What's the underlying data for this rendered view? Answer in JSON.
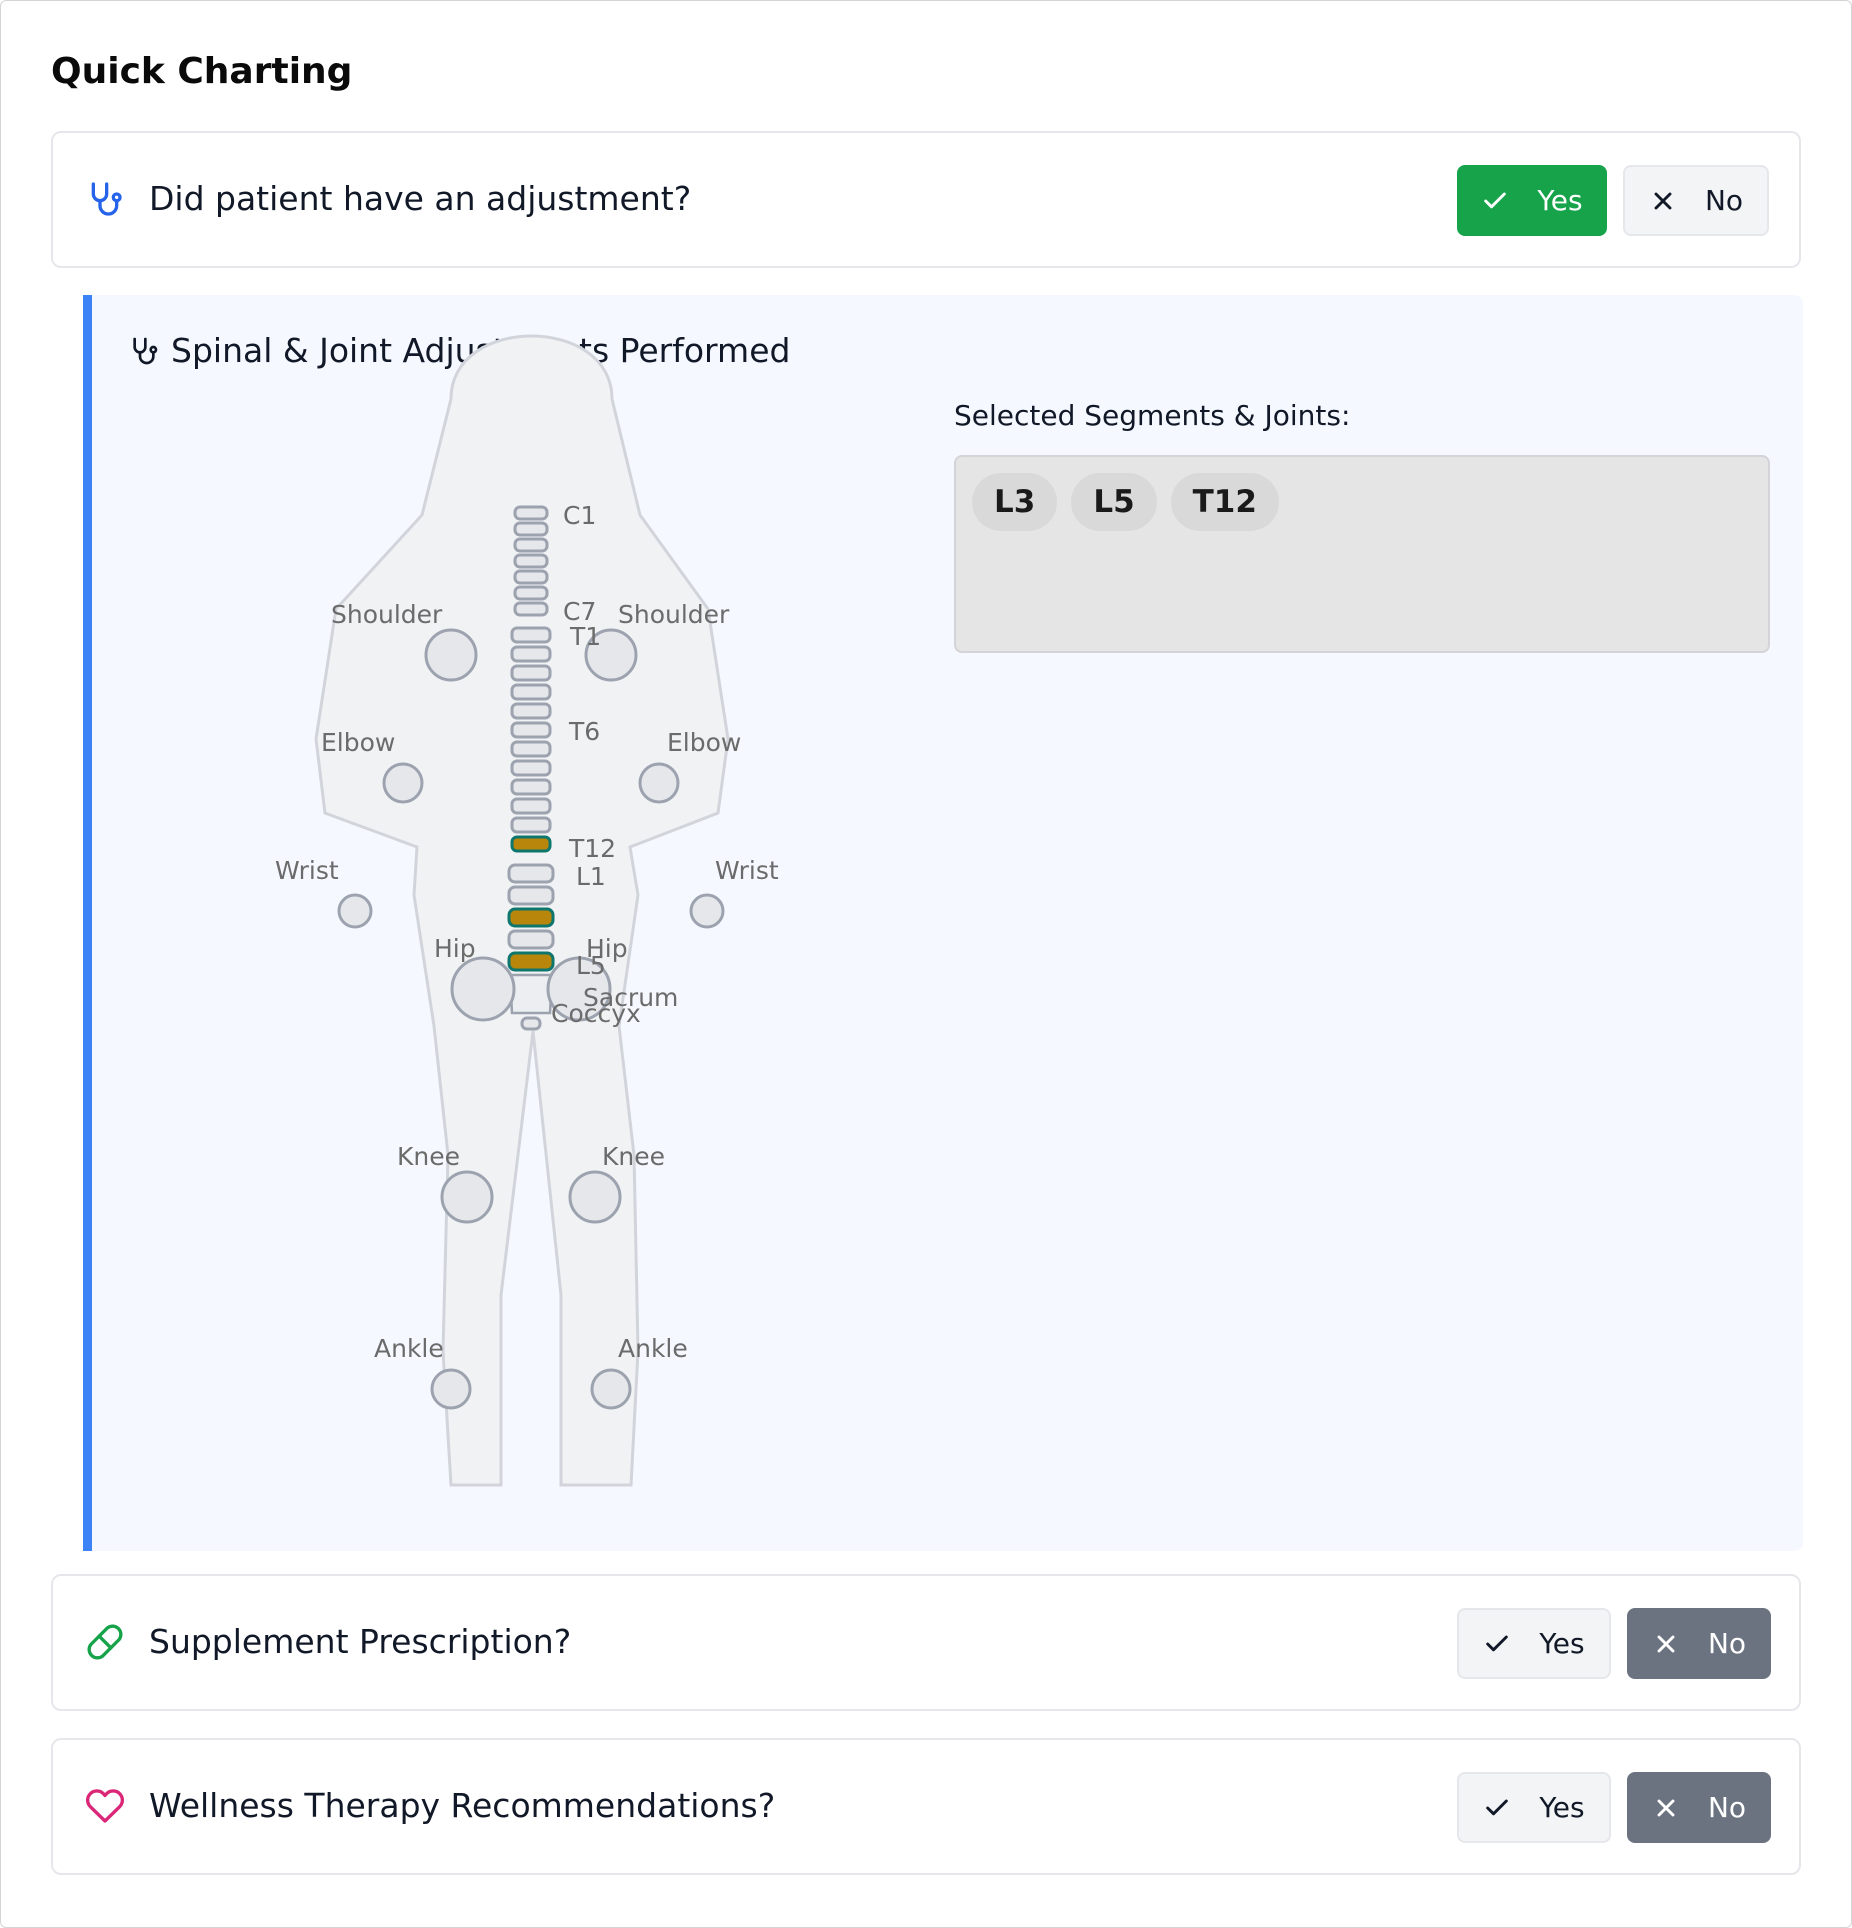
{
  "page": {
    "title": "Quick Charting"
  },
  "questions": [
    {
      "label": "Did patient have an adjustment?",
      "yes": "Yes",
      "no": "No",
      "answer": "yes",
      "icon": "stethoscope-icon",
      "icon_color": "#2563eb"
    },
    {
      "label": "Supplement Prescription?",
      "yes": "Yes",
      "no": "No",
      "answer": "no",
      "icon": "pill-icon",
      "icon_color": "#16a34a"
    },
    {
      "label": "Wellness Therapy Recommendations?",
      "yes": "Yes",
      "no": "No",
      "answer": "no",
      "icon": "heart-icon",
      "icon_color": "#db2777"
    }
  ],
  "adjustments": {
    "title": "Spinal & Joint Adjustments Performed",
    "icon": "stethoscope-icon",
    "selected_label": "Selected Segments & Joints:",
    "selected": [
      "L3",
      "L5",
      "T12"
    ],
    "spine_labels": {
      "c1": "C1",
      "c7": "C7",
      "t1": "T1",
      "t6": "T6",
      "t12": "T12",
      "l1": "L1",
      "l5": "L5",
      "sacrum": "Sacrum",
      "coccyx": "Coccyx"
    },
    "joint_labels": {
      "shoulder_left": "Shoulder",
      "shoulder_right": "Shoulder",
      "elbow_left": "Elbow",
      "elbow_right": "Elbow",
      "wrist_left": "Wrist",
      "wrist_right": "Wrist",
      "hip_left": "Hip",
      "hip_right": "Hip",
      "knee_left": "Knee",
      "knee_right": "Knee",
      "ankle_left": "Ankle",
      "ankle_right": "Ankle"
    }
  },
  "colors": {
    "accent_blue": "#3b82f6",
    "yes_active": "#16a34a",
    "no_active": "#6b7280",
    "vertebra_selected_fill": "#b8860b",
    "vertebra_selected_stroke": "#0f766e"
  }
}
